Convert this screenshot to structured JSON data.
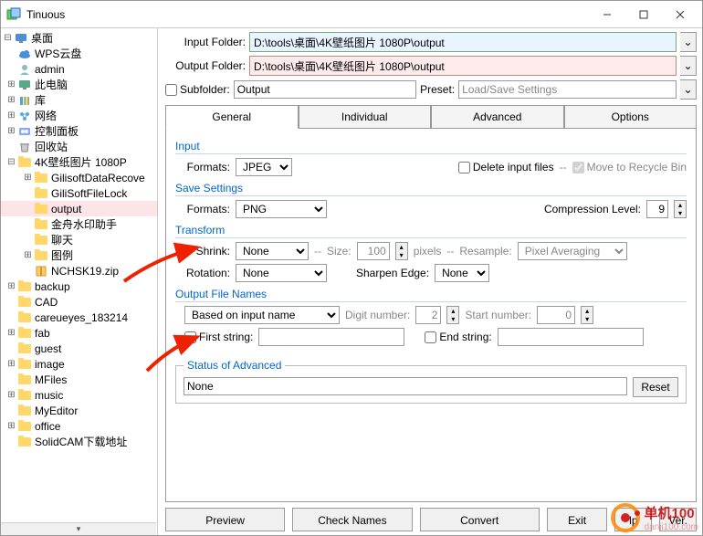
{
  "window": {
    "title": "Tinuous"
  },
  "tree": {
    "root": "桌面",
    "items": [
      {
        "indent": 0,
        "exp": "",
        "icon": "cloud",
        "label": "WPS云盘"
      },
      {
        "indent": 0,
        "exp": "",
        "icon": "user",
        "label": "admin"
      },
      {
        "indent": 0,
        "exp": "+",
        "icon": "pc",
        "label": "此电脑"
      },
      {
        "indent": 0,
        "exp": "+",
        "icon": "lib",
        "label": "库"
      },
      {
        "indent": 0,
        "exp": "+",
        "icon": "net",
        "label": "网络"
      },
      {
        "indent": 0,
        "exp": "+",
        "icon": "panel",
        "label": "控制面板"
      },
      {
        "indent": 0,
        "exp": "",
        "icon": "bin",
        "label": "回收站"
      },
      {
        "indent": 0,
        "exp": "-",
        "icon": "folder",
        "label": "4K壁纸图片 1080P"
      },
      {
        "indent": 1,
        "exp": "+",
        "icon": "folder",
        "label": "GilisoftDataRecove"
      },
      {
        "indent": 1,
        "exp": "",
        "icon": "folder",
        "label": "GiliSoftFileLock"
      },
      {
        "indent": 1,
        "exp": "",
        "icon": "folder",
        "label": "output",
        "sel": true
      },
      {
        "indent": 1,
        "exp": "",
        "icon": "folder",
        "label": "金舟水印助手"
      },
      {
        "indent": 1,
        "exp": "",
        "icon": "folder",
        "label": "聊天"
      },
      {
        "indent": 1,
        "exp": "+",
        "icon": "folder",
        "label": "图例"
      },
      {
        "indent": 1,
        "exp": "",
        "icon": "zip",
        "label": "NCHSK19.zip"
      },
      {
        "indent": 0,
        "exp": "+",
        "icon": "folder",
        "label": "backup"
      },
      {
        "indent": 0,
        "exp": "",
        "icon": "folder",
        "label": "CAD"
      },
      {
        "indent": 0,
        "exp": "",
        "icon": "folder",
        "label": "careueyes_183214"
      },
      {
        "indent": 0,
        "exp": "+",
        "icon": "folder",
        "label": "fab"
      },
      {
        "indent": 0,
        "exp": "",
        "icon": "folder",
        "label": "guest"
      },
      {
        "indent": 0,
        "exp": "+",
        "icon": "folder",
        "label": "image"
      },
      {
        "indent": 0,
        "exp": "",
        "icon": "folder",
        "label": "MFiles"
      },
      {
        "indent": 0,
        "exp": "+",
        "icon": "folder",
        "label": "music"
      },
      {
        "indent": 0,
        "exp": "",
        "icon": "folder",
        "label": "MyEditor"
      },
      {
        "indent": 0,
        "exp": "+",
        "icon": "folder",
        "label": "office"
      },
      {
        "indent": 0,
        "exp": "",
        "icon": "folder",
        "label": "SolidCAM下载地址"
      }
    ]
  },
  "paths": {
    "input_label": "Input Folder:",
    "input_value": "D:\\tools\\桌面\\4K壁纸图片 1080P\\output",
    "output_label": "Output Folder:",
    "output_value": "D:\\tools\\桌面\\4K壁纸图片 1080P\\output",
    "subfolder_label": "Subfolder:",
    "subfolder_value": "Output",
    "preset_label": "Preset:",
    "preset_value": "Load/Save Settings"
  },
  "tabs": {
    "general": "General",
    "individual": "Individual",
    "advanced": "Advanced",
    "options": "Options"
  },
  "sections": {
    "input": {
      "title": "Input",
      "formats_label": "Formats:",
      "formats_value": "JPEG",
      "delete_label": "Delete input files",
      "recycle_label": "Move to Recycle Bin",
      "dash": "--"
    },
    "save": {
      "title": "Save Settings",
      "formats_label": "Formats:",
      "formats_value": "PNG",
      "compression_label": "Compression Level:",
      "compression_value": "9"
    },
    "transform": {
      "title": "Transform",
      "shrink_label": "Shrink:",
      "shrink_value": "None",
      "size_label": "Size:",
      "size_value": "100",
      "pixels": "pixels",
      "resample_label": "Resample:",
      "resample_value": "Pixel Averaging",
      "rotation_label": "Rotation:",
      "rotation_value": "None",
      "sharpen_label": "Sharpen Edge:",
      "sharpen_value": "None",
      "dash": "--"
    },
    "output": {
      "title": "Output File Names",
      "mode": "Based on input name",
      "digit_label": "Digit number:",
      "digit_value": "2",
      "start_label": "Start number:",
      "start_value": "0",
      "first_string": "First string:",
      "end_string": "End string:"
    },
    "advanced": {
      "title": "Status of Advanced",
      "value": "None",
      "reset": "Reset"
    }
  },
  "buttons": {
    "preview": "Preview",
    "check": "Check Names",
    "convert": "Convert",
    "exit": "Exit",
    "lp": "lp",
    "ver": "Ver."
  },
  "watermark": {
    "text": "单机100",
    "url": "danji100.com"
  }
}
